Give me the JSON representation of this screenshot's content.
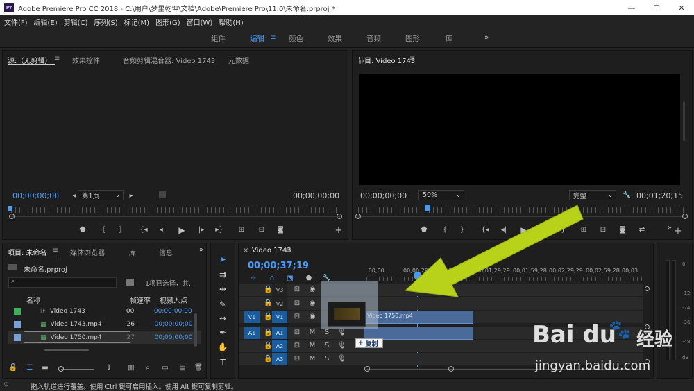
{
  "titlebar": {
    "logo": "Pr",
    "title": "Adobe Premiere Pro CC 2018 - C:\\用户\\梦里乾坤\\文档\\Adobe\\Premiere Pro\\11.0\\未命名.prproj *",
    "minimize": "—",
    "maximize": "☐",
    "close": "✕"
  },
  "menu": [
    "文件(F)",
    "编辑(E)",
    "剪辑(C)",
    "序列(S)",
    "标记(M)",
    "图形(G)",
    "窗口(W)",
    "帮助(H)"
  ],
  "workspaces": [
    "组件",
    "编辑",
    "颜色",
    "效果",
    "音频",
    "图形",
    "库",
    "»"
  ],
  "workspace_menu_icon": "≡",
  "source": {
    "tabs": [
      "源:（无剪辑）",
      "效果控件",
      "音频剪辑混合器: Video 1743",
      "元数据"
    ],
    "tab_menu": "≡",
    "timecode_left": "00;00;00;00",
    "page_select": "第1页",
    "timecode_right": "00;00;00;00"
  },
  "program": {
    "tab": "节目: Video 1743",
    "tab_menu": "≡",
    "timecode_left": "00;00;00;00",
    "zoom": "50%",
    "quality": "完整",
    "timecode_right": "00;01;20;15"
  },
  "project": {
    "tabs": [
      "项目: 未命名",
      "媒体浏览器",
      "库",
      "信息"
    ],
    "more": "»",
    "file": "未命名.prproj",
    "selection_info": "1项已选择，共...",
    "col_name": "名称",
    "col_rate": "帧速率",
    "col_in": "视频入点",
    "items": [
      {
        "name": "Video 1743",
        "rate": "00",
        "in": "00;00;00;00",
        "color": "#3fae5a"
      },
      {
        "name": "Video 1743.mp4",
        "rate": "26",
        "in": "00;00;00;00",
        "color": "#7aa0d8"
      },
      {
        "name": "Video 1750.mp4",
        "rate": "27",
        "in": "00;00;00;00",
        "color": "#7aa0d8"
      }
    ]
  },
  "timeline": {
    "tab": "Video 1743",
    "tab_menu": "≡",
    "timecode": "00;00;37;19",
    "ruler_labels": [
      ":00;00",
      "00;00;29;29",
      "00;00;59;28",
      "00;01;29;29",
      "00;01;59;28",
      "00;02;29;29",
      "00;02;59;28",
      "00;03"
    ],
    "video_tracks": [
      "V3",
      "V2",
      "V1"
    ],
    "audio_tracks": [
      "A1",
      "A2",
      "A3"
    ],
    "source_v": "V1",
    "source_a": "A1",
    "mute": "M",
    "solo": "S",
    "clip_label": "Video 1750.mp4",
    "copy_tooltip": "复制",
    "copy_plus": "+"
  },
  "meter_labels": [
    "0",
    "-12",
    "-24",
    "-36",
    "-48",
    "dB"
  ],
  "status": "拖入轨道进行覆盖。使用 Ctrl 键可启用插入。使用 Alt 键可复制剪辑。",
  "watermark": {
    "brand": "Bai du",
    "paw": "🐾",
    "cn": "经验",
    "url": "jingyan.baidu.com"
  },
  "colors": {
    "accent": "#4a9af5",
    "arrow": "#b8d219"
  }
}
